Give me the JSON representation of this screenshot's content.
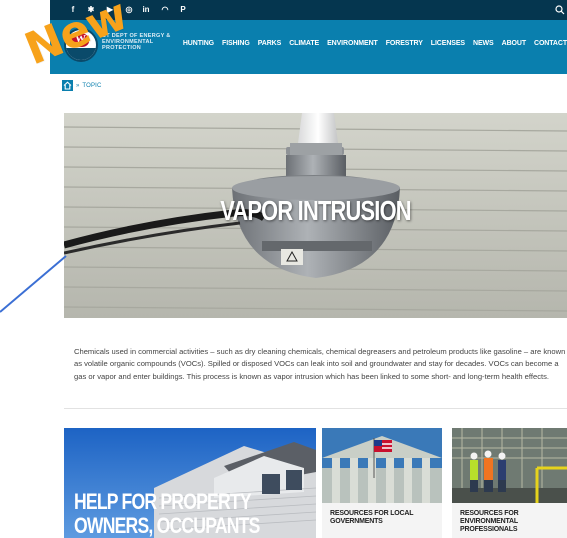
{
  "colors": {
    "social_bar": "#05364f",
    "nav_bar": "#0a7fae",
    "accent": "#0a7fae",
    "new_label": "#f7a21b",
    "pointer_line": "#3b6fd4"
  },
  "annotation": {
    "new_label": "New"
  },
  "social": {
    "icons": [
      "facebook-icon",
      "twitter-icon",
      "youtube-icon",
      "instagram-icon",
      "linkedin-icon",
      "podcast-icon",
      "pinterest-icon"
    ],
    "glyphs": {
      "facebook": "f",
      "twitter": "✱",
      "youtube": "▶",
      "instagram": "◎",
      "linkedin": "in",
      "podcast": "◠",
      "pinterest": "P"
    }
  },
  "header": {
    "logo_text": "CT DEPT OF ENERGY & ENVIRONMENTAL PROTECTION",
    "logo_letter": "W",
    "nav": [
      "HUNTING",
      "FISHING",
      "PARKS",
      "CLIMATE",
      "ENVIRONMENT",
      "FORESTRY",
      "LICENSES",
      "NEWS",
      "ABOUT",
      "CONTACT"
    ]
  },
  "breadcrumb": {
    "separator": "»",
    "current": "TOPIC"
  },
  "hero": {
    "title": "VAPOR INTRUSION"
  },
  "intro": {
    "text": "Chemicals used in commercial activities – such as dry cleaning chemicals, chemical degreasers and petroleum products like gasoline – are known as volatile organic compounds (VOCs). Spilled or disposed VOCs can leak into soil and groundwater and stay for decades. VOCs can become a gas or vapor and enter buildings. This process is known as vapor intrusion which has been linked to some short- and long-term health effects."
  },
  "cards": {
    "property": "HELP FOR PROPERTY OWNERS, OCCUPANTS",
    "local_gov": "RESOURCES FOR LOCAL GOVERNMENTS",
    "env_pros": "RESOURCES FOR ENVIRONMENTAL PROFESSIONALS"
  }
}
